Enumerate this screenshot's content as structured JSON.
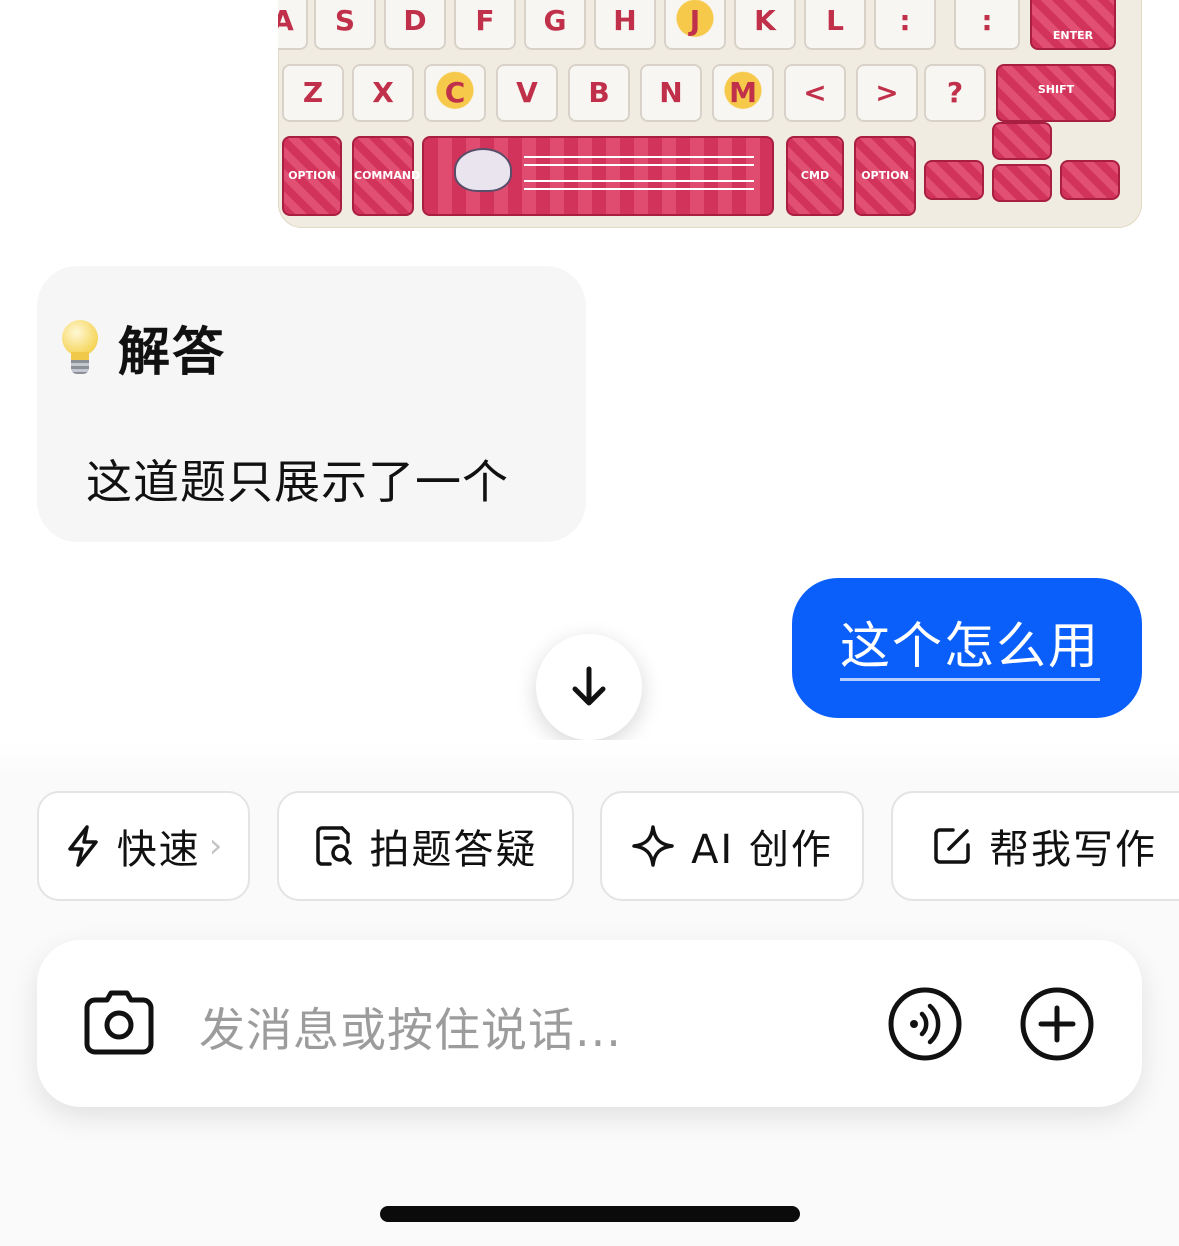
{
  "photo": {
    "row1_keys": [
      "A",
      "S",
      "D",
      "F",
      "G",
      "H",
      "J",
      "K",
      "L",
      ":",
      ":",
      "ENTER"
    ],
    "row2_keys": [
      "Z",
      "X",
      "C",
      "V",
      "B",
      "N",
      "M",
      "<",
      ">",
      "?",
      "SHIFT"
    ],
    "row3_labels": [
      "OPTION",
      "COMMAND",
      "CMD",
      "OPTION"
    ]
  },
  "answer": {
    "title": "解答",
    "body": "这道题只展示了一个"
  },
  "user_message": "这个怎么用",
  "chips": [
    {
      "label": "快速",
      "icon": "lightning-icon"
    },
    {
      "label": "拍题答疑",
      "icon": "scan-question-icon"
    },
    {
      "label": "AI 创作",
      "icon": "sparkle-icon"
    },
    {
      "label": "帮我写作",
      "icon": "edit-icon"
    }
  ],
  "input": {
    "placeholder": "发消息或按住说话..."
  },
  "colors": {
    "accent": "#0a5ffb",
    "bubble_gray": "#f6f6f6",
    "keycap_red": "#d2335a"
  }
}
